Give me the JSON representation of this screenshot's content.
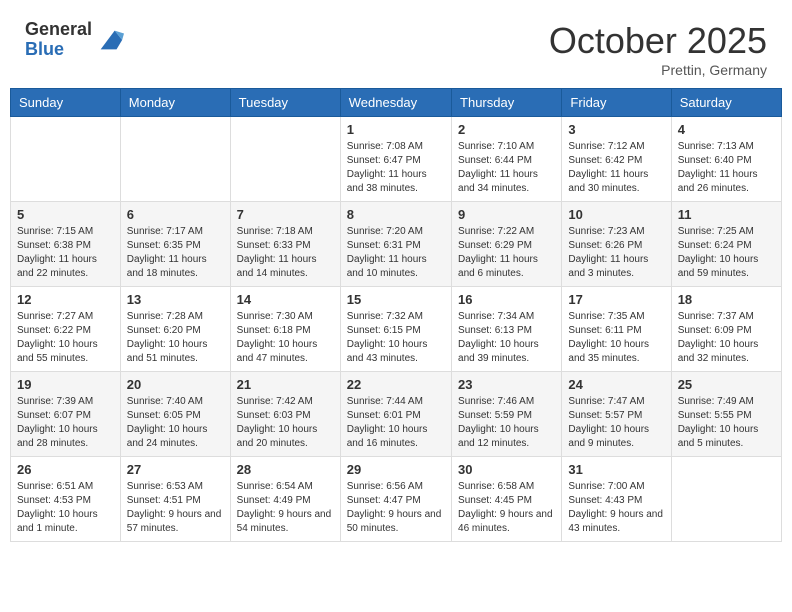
{
  "header": {
    "logo_general": "General",
    "logo_blue": "Blue",
    "month_title": "October 2025",
    "location": "Prettin, Germany"
  },
  "days_of_week": [
    "Sunday",
    "Monday",
    "Tuesday",
    "Wednesday",
    "Thursday",
    "Friday",
    "Saturday"
  ],
  "weeks": [
    [
      {
        "day": "",
        "info": ""
      },
      {
        "day": "",
        "info": ""
      },
      {
        "day": "",
        "info": ""
      },
      {
        "day": "1",
        "info": "Sunrise: 7:08 AM\nSunset: 6:47 PM\nDaylight: 11 hours\nand 38 minutes."
      },
      {
        "day": "2",
        "info": "Sunrise: 7:10 AM\nSunset: 6:44 PM\nDaylight: 11 hours\nand 34 minutes."
      },
      {
        "day": "3",
        "info": "Sunrise: 7:12 AM\nSunset: 6:42 PM\nDaylight: 11 hours\nand 30 minutes."
      },
      {
        "day": "4",
        "info": "Sunrise: 7:13 AM\nSunset: 6:40 PM\nDaylight: 11 hours\nand 26 minutes."
      }
    ],
    [
      {
        "day": "5",
        "info": "Sunrise: 7:15 AM\nSunset: 6:38 PM\nDaylight: 11 hours\nand 22 minutes."
      },
      {
        "day": "6",
        "info": "Sunrise: 7:17 AM\nSunset: 6:35 PM\nDaylight: 11 hours\nand 18 minutes."
      },
      {
        "day": "7",
        "info": "Sunrise: 7:18 AM\nSunset: 6:33 PM\nDaylight: 11 hours\nand 14 minutes."
      },
      {
        "day": "8",
        "info": "Sunrise: 7:20 AM\nSunset: 6:31 PM\nDaylight: 11 hours\nand 10 minutes."
      },
      {
        "day": "9",
        "info": "Sunrise: 7:22 AM\nSunset: 6:29 PM\nDaylight: 11 hours\nand 6 minutes."
      },
      {
        "day": "10",
        "info": "Sunrise: 7:23 AM\nSunset: 6:26 PM\nDaylight: 11 hours\nand 3 minutes."
      },
      {
        "day": "11",
        "info": "Sunrise: 7:25 AM\nSunset: 6:24 PM\nDaylight: 10 hours\nand 59 minutes."
      }
    ],
    [
      {
        "day": "12",
        "info": "Sunrise: 7:27 AM\nSunset: 6:22 PM\nDaylight: 10 hours\nand 55 minutes."
      },
      {
        "day": "13",
        "info": "Sunrise: 7:28 AM\nSunset: 6:20 PM\nDaylight: 10 hours\nand 51 minutes."
      },
      {
        "day": "14",
        "info": "Sunrise: 7:30 AM\nSunset: 6:18 PM\nDaylight: 10 hours\nand 47 minutes."
      },
      {
        "day": "15",
        "info": "Sunrise: 7:32 AM\nSunset: 6:15 PM\nDaylight: 10 hours\nand 43 minutes."
      },
      {
        "day": "16",
        "info": "Sunrise: 7:34 AM\nSunset: 6:13 PM\nDaylight: 10 hours\nand 39 minutes."
      },
      {
        "day": "17",
        "info": "Sunrise: 7:35 AM\nSunset: 6:11 PM\nDaylight: 10 hours\nand 35 minutes."
      },
      {
        "day": "18",
        "info": "Sunrise: 7:37 AM\nSunset: 6:09 PM\nDaylight: 10 hours\nand 32 minutes."
      }
    ],
    [
      {
        "day": "19",
        "info": "Sunrise: 7:39 AM\nSunset: 6:07 PM\nDaylight: 10 hours\nand 28 minutes."
      },
      {
        "day": "20",
        "info": "Sunrise: 7:40 AM\nSunset: 6:05 PM\nDaylight: 10 hours\nand 24 minutes."
      },
      {
        "day": "21",
        "info": "Sunrise: 7:42 AM\nSunset: 6:03 PM\nDaylight: 10 hours\nand 20 minutes."
      },
      {
        "day": "22",
        "info": "Sunrise: 7:44 AM\nSunset: 6:01 PM\nDaylight: 10 hours\nand 16 minutes."
      },
      {
        "day": "23",
        "info": "Sunrise: 7:46 AM\nSunset: 5:59 PM\nDaylight: 10 hours\nand 12 minutes."
      },
      {
        "day": "24",
        "info": "Sunrise: 7:47 AM\nSunset: 5:57 PM\nDaylight: 10 hours\nand 9 minutes."
      },
      {
        "day": "25",
        "info": "Sunrise: 7:49 AM\nSunset: 5:55 PM\nDaylight: 10 hours\nand 5 minutes."
      }
    ],
    [
      {
        "day": "26",
        "info": "Sunrise: 6:51 AM\nSunset: 4:53 PM\nDaylight: 10 hours\nand 1 minute."
      },
      {
        "day": "27",
        "info": "Sunrise: 6:53 AM\nSunset: 4:51 PM\nDaylight: 9 hours\nand 57 minutes."
      },
      {
        "day": "28",
        "info": "Sunrise: 6:54 AM\nSunset: 4:49 PM\nDaylight: 9 hours\nand 54 minutes."
      },
      {
        "day": "29",
        "info": "Sunrise: 6:56 AM\nSunset: 4:47 PM\nDaylight: 9 hours\nand 50 minutes."
      },
      {
        "day": "30",
        "info": "Sunrise: 6:58 AM\nSunset: 4:45 PM\nDaylight: 9 hours\nand 46 minutes."
      },
      {
        "day": "31",
        "info": "Sunrise: 7:00 AM\nSunset: 4:43 PM\nDaylight: 9 hours\nand 43 minutes."
      },
      {
        "day": "",
        "info": ""
      }
    ]
  ]
}
